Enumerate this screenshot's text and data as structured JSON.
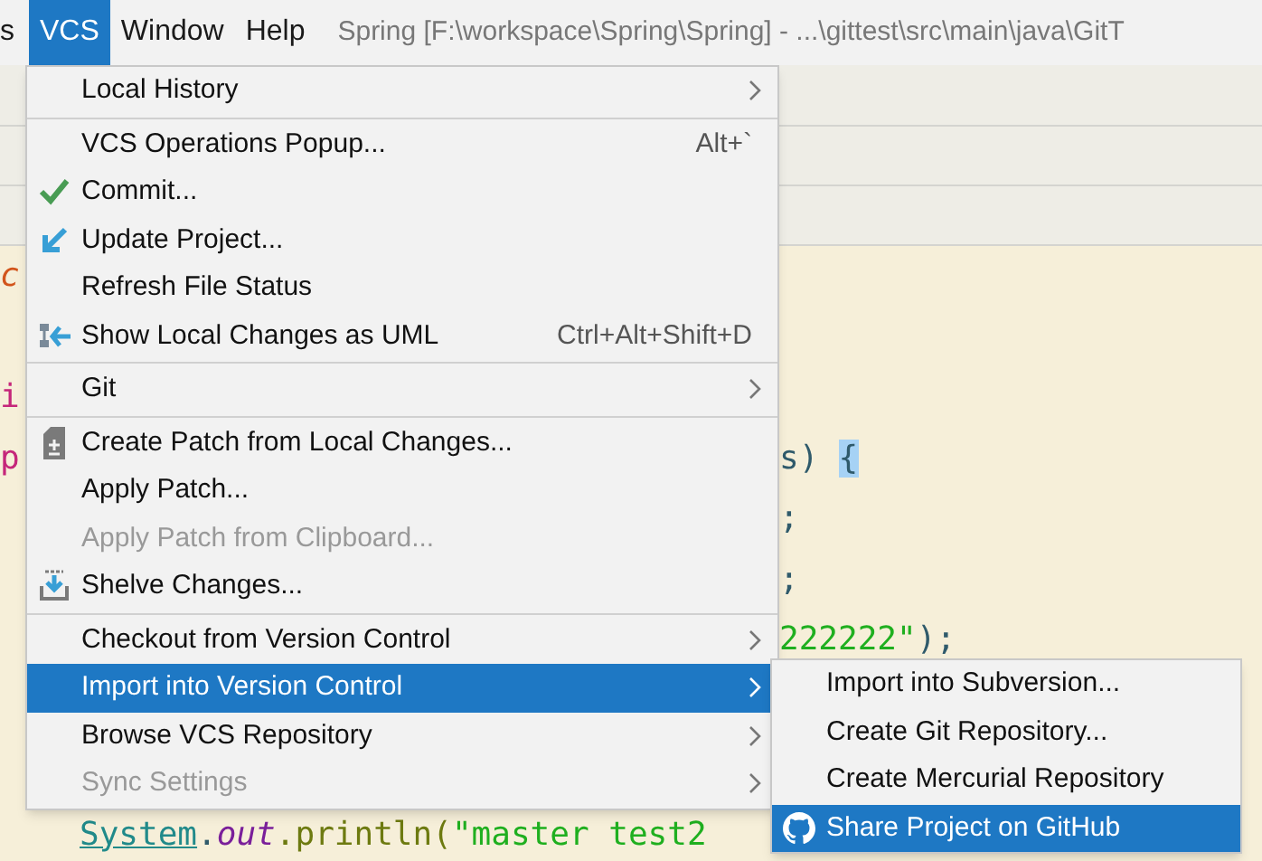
{
  "menubar": {
    "items": [
      {
        "label": "s",
        "selected": false
      },
      {
        "label": "VCS",
        "selected": true
      },
      {
        "label": "Window",
        "selected": false
      },
      {
        "label": "Help",
        "selected": false
      }
    ],
    "title": "Spring [F:\\workspace\\Spring\\Spring] - ...\\gittest\\src\\main\\java\\GitT"
  },
  "editor": {
    "rows": [
      {
        "left": [
          {
            "text": "c",
            "kind": "keyword_italic"
          }
        ],
        "right": []
      },
      {
        "left": [],
        "right": []
      },
      {
        "left": [
          {
            "text": "i",
            "kind": "keyword"
          }
        ],
        "right": []
      },
      {
        "left": [
          {
            "text": "p",
            "kind": "keyword"
          }
        ],
        "right": [
          {
            "text": "s)",
            "kind": "plain"
          },
          {
            "text": "{",
            "kind": "brace_match"
          }
        ]
      },
      {
        "left": [],
        "right": [
          {
            "text": ";",
            "kind": "plain"
          }
        ]
      },
      {
        "left": [],
        "right": [
          {
            "text": ";",
            "kind": "plain"
          }
        ]
      },
      {
        "left": [],
        "right": [
          {
            "text": "222222\"",
            "kind": "string"
          },
          {
            "text": ");",
            "kind": "plain"
          }
        ]
      },
      {
        "left": [],
        "right": []
      },
      {
        "left": [],
        "right": []
      },
      {
        "left": [],
        "right": [],
        "bottom": [
          {
            "text": "System",
            "kind": "class"
          },
          {
            "text": ".",
            "kind": "plain"
          },
          {
            "text": "out",
            "kind": "field"
          },
          {
            "text": ".println(",
            "kind": "method"
          },
          {
            "text": "\"master test2",
            "kind": "string"
          }
        ]
      }
    ]
  },
  "vcs_menu": {
    "items": [
      {
        "kind": "item",
        "label": "Local History",
        "submenu": true,
        "disabled": false,
        "selected": false
      },
      {
        "kind": "separator"
      },
      {
        "kind": "item",
        "label": "VCS Operations Popup...",
        "shortcut": "Alt+`",
        "disabled": false,
        "selected": false
      },
      {
        "kind": "item",
        "label": "Commit...",
        "disabled": false,
        "selected": false
      },
      {
        "kind": "item",
        "label": "Update Project...",
        "disabled": false,
        "selected": false
      },
      {
        "kind": "item",
        "label": "Refresh File Status",
        "disabled": false,
        "selected": false
      },
      {
        "kind": "item",
        "label": "Show Local Changes as UML",
        "shortcut": "Ctrl+Alt+Shift+D",
        "disabled": false,
        "selected": false
      },
      {
        "kind": "separator"
      },
      {
        "kind": "item",
        "label": "Git",
        "submenu": true,
        "disabled": false,
        "selected": false
      },
      {
        "kind": "separator"
      },
      {
        "kind": "item",
        "label": "Create Patch from Local Changes...",
        "disabled": false,
        "selected": false
      },
      {
        "kind": "item",
        "label": "Apply Patch...",
        "disabled": false,
        "selected": false
      },
      {
        "kind": "item",
        "label": "Apply Patch from Clipboard...",
        "disabled": true,
        "selected": false
      },
      {
        "kind": "item",
        "label": "Shelve Changes...",
        "disabled": false,
        "selected": false
      },
      {
        "kind": "separator"
      },
      {
        "kind": "item",
        "label": "Checkout from Version Control",
        "submenu": true,
        "disabled": false,
        "selected": false
      },
      {
        "kind": "item",
        "label": "Import into Version Control",
        "submenu": true,
        "disabled": false,
        "selected": true
      },
      {
        "kind": "item",
        "label": "Browse VCS Repository",
        "submenu": true,
        "disabled": false,
        "selected": false
      },
      {
        "kind": "item",
        "label": "Sync Settings",
        "submenu": true,
        "disabled": true,
        "selected": false
      }
    ]
  },
  "import_submenu": {
    "items": [
      {
        "label": "Import into Subversion...",
        "selected": false
      },
      {
        "label": "Create Git Repository...",
        "selected": false
      },
      {
        "label": "Create Mercurial Repository",
        "selected": false
      },
      {
        "label": "Share Project on GitHub",
        "selected": true
      }
    ]
  }
}
